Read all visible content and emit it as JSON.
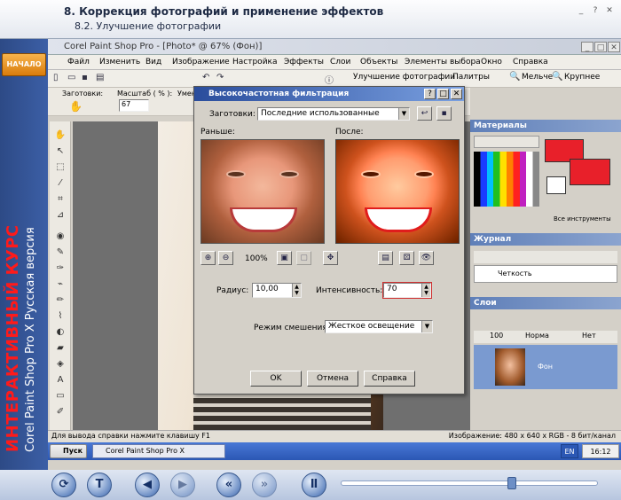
{
  "course": {
    "title": "8. Коррекция фотографий и применение эффектов",
    "subtitle": "8.2. Улучшение фотографии",
    "start_button": "НАЧАЛО",
    "promo_line1": "ИНТЕРАКТИВНЫЙ КУРС",
    "promo_line2": "Corel Paint Shop Pro X Русская версия"
  },
  "app": {
    "title": "Corel Paint Shop Pro - [Photo* @ 67% (Фон)]",
    "menu": [
      "Файл",
      "Изменить",
      "Вид",
      "Изображение",
      "Настройка",
      "Эффекты",
      "Слои",
      "Объекты",
      "Элементы выбора",
      "Окно",
      "Справка"
    ],
    "toolbar": {
      "enhance": "Улучшение фотографии",
      "palettes": "Палитры",
      "zoom_out": "Мельче",
      "zoom_in": "Крупнее",
      "presets_label": "Заготовки:",
      "scale_label": "Масштаб ( % ):",
      "scale_value": "67",
      "truncated_label": "Умен"
    },
    "status": {
      "left": "Для вывода справки нажмите клавишу F1",
      "right": "Изображение:  480 x 640 x RGB - 8 бит/канал"
    }
  },
  "dialog": {
    "title": "Высокочастотная фильтрация",
    "presets_label": "Заготовки:",
    "presets_value": "Последние использованные",
    "before_label": "Раньше:",
    "after_label": "После:",
    "zoom_percent": "100%",
    "radius_label": "Радиус:",
    "radius_value": "10,00",
    "intensity_label": "Интенсивность:",
    "intensity_value": "70",
    "blend_label": "Режим смешения:",
    "blend_value": "Жесткое освещение",
    "ok": "OK",
    "cancel": "Отмена",
    "help": "Справка"
  },
  "panels": {
    "materials": "Материалы",
    "all_tools": "Все инструменты",
    "journal": "Журнал",
    "journal_item": "Четкость",
    "layers": "Слои",
    "opacity": "100",
    "blend_mode": "Норма",
    "no_label": "Нет",
    "layer_name": "Фон"
  },
  "taskbar": {
    "start": "Пуск",
    "item": "Corel Paint Shop Pro X",
    "lang": "EN",
    "clock": "16:12"
  },
  "colors": {
    "accent_red": "#ff1a1a",
    "title_blue": "#2a4d9c",
    "swatch_red": "#e8202a"
  }
}
